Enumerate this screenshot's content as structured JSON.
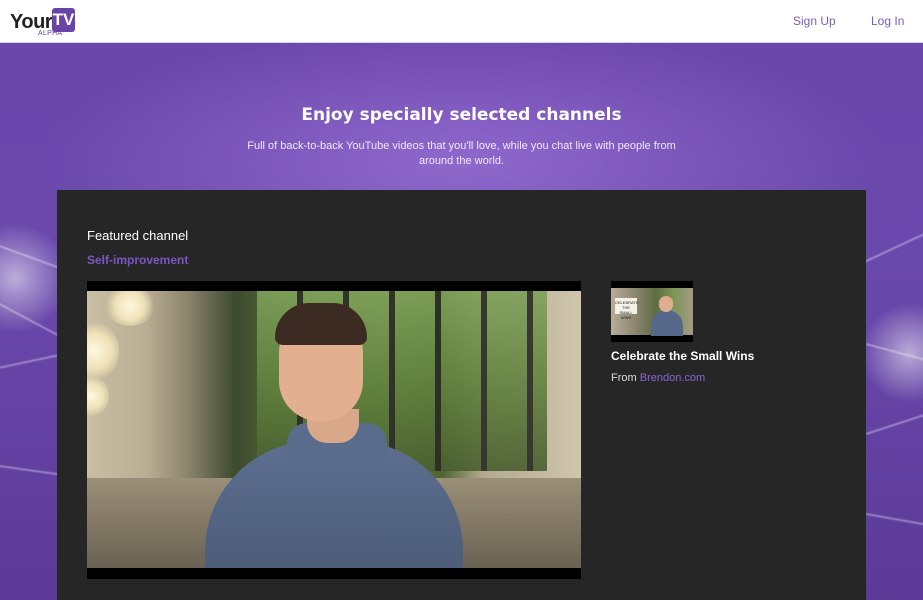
{
  "header": {
    "logo": {
      "your": "Your",
      "tv": "TV",
      "alpha": "ALPHA"
    },
    "nav": {
      "signup": "Sign Up",
      "login": "Log In"
    }
  },
  "hero": {
    "title": "Enjoy specially selected channels",
    "subtitle": "Full of back-to-back YouTube videos that you'll love, while you chat live with people from around the world."
  },
  "featured": {
    "label": "Featured channel",
    "channel": "Self-improvement"
  },
  "video_card": {
    "thumb_text": "CELEBRATE THE SMALL WINS",
    "title": "Celebrate the Small Wins",
    "from_prefix": "From",
    "source": "Brendon.com"
  },
  "colors": {
    "accent": "#6a43a6",
    "link": "#7a5bbf",
    "panel": "#262626",
    "hero": "#6b49a8"
  }
}
